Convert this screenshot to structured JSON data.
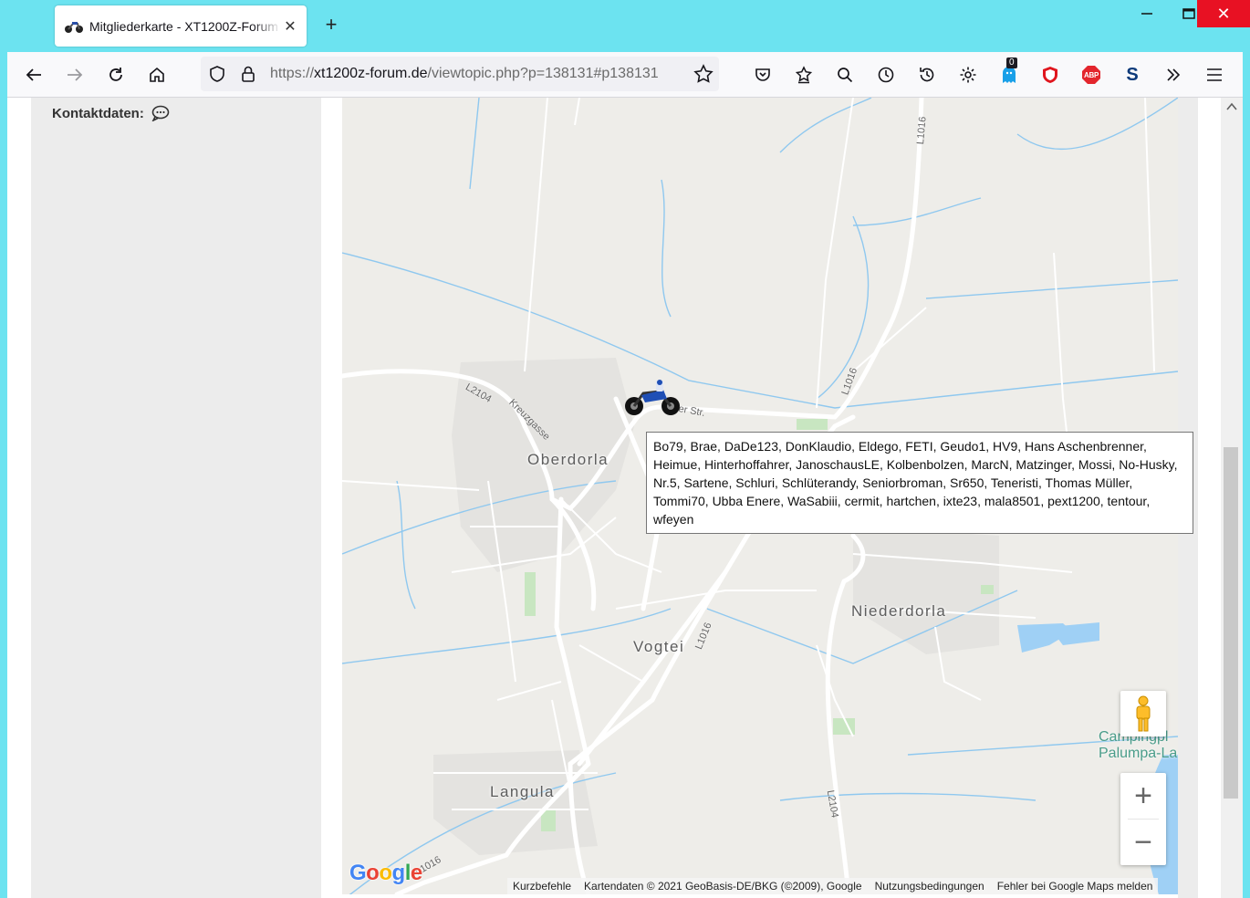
{
  "browser": {
    "tab": {
      "title": "Mitgliederkarte - XT1200Z-Forum",
      "close": "✕"
    },
    "new_tab": "+",
    "window": {
      "minimize": "—",
      "maximize": "☐",
      "close": "✕"
    },
    "url": {
      "scheme": "https://",
      "host": "xt1200z-forum.de",
      "path": "/viewtopic.php?p=138131#p138131"
    },
    "extension_badge": "0",
    "abp_label": "ABP",
    "s_label": "S"
  },
  "sidebar": {
    "contact_label": "Kontaktdaten:"
  },
  "map": {
    "places": {
      "oberdorla": "Oberdorla",
      "niederdorla": "Niederdorla",
      "vogtei": "Vogtei",
      "langula": "Langula",
      "camping_line1": "Campingpl",
      "camping_line2": "Palumpa-La"
    },
    "roads": {
      "l2104_west": "L2104",
      "kreuzgasse": "Kreuzgasse",
      "muehlhaeuser_str": "ser Str.",
      "l1016_north": "L1016",
      "l1016_mid": "L1016",
      "l1016_south": "L1016",
      "l1016_bottom": "L1016",
      "l2104_south": "L2104"
    },
    "tooltip": "Bo79, Brae, DaDe123, DonKlaudio, Eldego, FETI, Geudo1, HV9, Hans Aschenbrenner, Heimue, Hinterhoffahrer, JanoschausLE, Kolbenbolzen, MarcN, Matzinger, Mossi, No-Husky, Nr.5, Sartene, Schluri, Schlüterandy, Seniorbroman, Sr650, Teneristi, Thomas Müller, Tommi70, Ubba Enere, WaSabiii, cermit, hartchen, ixte23, mala8501, pext1200, tentour, wfeyen",
    "zoom_in": "+",
    "zoom_out": "−",
    "attribution": {
      "shortcuts": "Kurzbefehle",
      "map_data": "Kartendaten © 2021 GeoBasis-DE/BKG (©2009), Google",
      "terms": "Nutzungsbedingungen",
      "report": "Fehler bei Google Maps melden"
    },
    "logo": [
      "G",
      "o",
      "o",
      "g",
      "l",
      "e"
    ],
    "colors": {
      "land": "#eeede9",
      "road": "#ffffff",
      "water": "#8fc8ef",
      "lake": "#9fd0f5",
      "green": "#c8e6c1",
      "titlebar": "#6ce3f0",
      "close": "#e81123"
    }
  }
}
